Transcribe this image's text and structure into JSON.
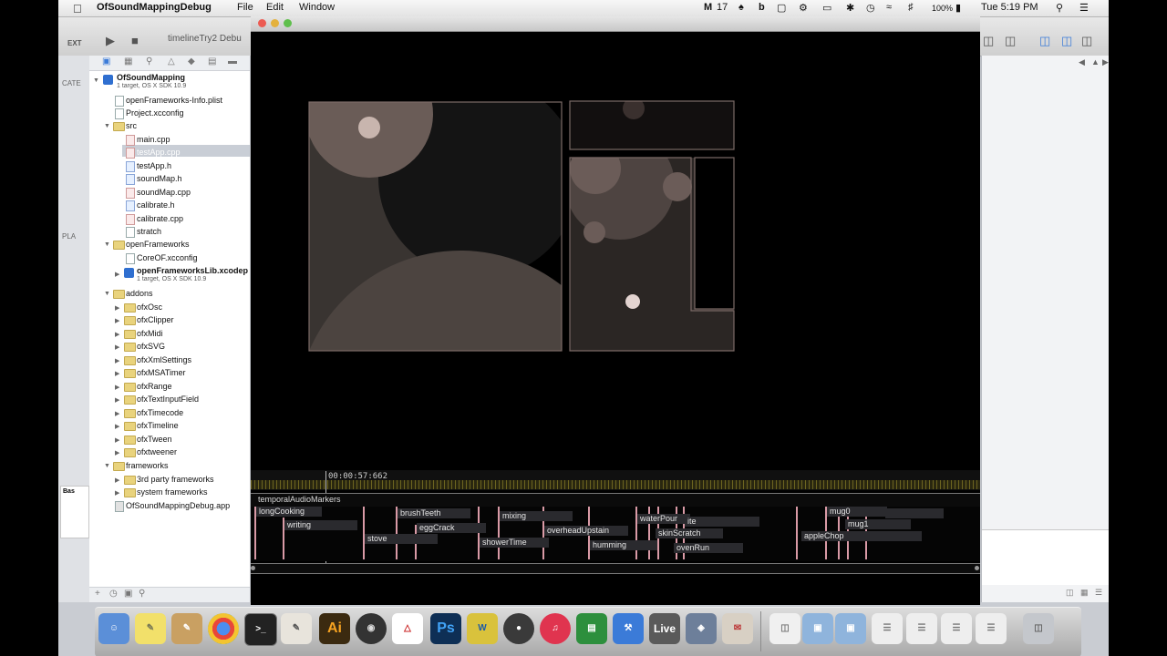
{
  "menubar": {
    "app_name": "OfSoundMappingDebug",
    "menus": [
      "File",
      "Edit",
      "Window"
    ],
    "status": {
      "gmail_count": "17",
      "battery": "100%",
      "clock": "Tue 5:19 PM"
    }
  },
  "xcode": {
    "scheme_label": "timelineTry2 Debu",
    "left_strip_labels": [
      "EXT",
      "CATE",
      "PLA",
      "Bas"
    ],
    "navigator": {
      "project": {
        "name": "OfSoundMapping",
        "subtitle": "1 target, OS X SDK 10.9"
      },
      "rows": [
        {
          "label": "openFrameworks-Info.plist"
        },
        {
          "label": "Project.xcconfig"
        },
        {
          "label": "src"
        },
        {
          "label": "main.cpp"
        },
        {
          "label": "testApp.cpp"
        },
        {
          "label": "testApp.h"
        },
        {
          "label": "soundMap.h"
        },
        {
          "label": "soundMap.cpp"
        },
        {
          "label": "calibrate.h"
        },
        {
          "label": "calibrate.cpp"
        },
        {
          "label": "stratch"
        },
        {
          "label": "openFrameworks"
        },
        {
          "label": "CoreOF.xcconfig"
        },
        {
          "label": "openFrameworksLib.xcodep"
        },
        {
          "label": "1 target, OS X SDK 10.9"
        },
        {
          "label": "addons"
        },
        {
          "label": "ofxOsc"
        },
        {
          "label": "ofxClipper"
        },
        {
          "label": "ofxMidi"
        },
        {
          "label": "ofxSVG"
        },
        {
          "label": "ofxXmlSettings"
        },
        {
          "label": "ofxMSATimer"
        },
        {
          "label": "ofxRange"
        },
        {
          "label": "ofxTextInputField"
        },
        {
          "label": "ofxTimecode"
        },
        {
          "label": "ofxTimeline"
        },
        {
          "label": "ofxTween"
        },
        {
          "label": "ofxtweener"
        },
        {
          "label": "frameworks"
        },
        {
          "label": "3rd party frameworks"
        },
        {
          "label": "system frameworks"
        },
        {
          "label": "OfSoundMappingDebug.app"
        }
      ]
    }
  },
  "timeline": {
    "timecode": "00:00:57:662",
    "track_name": "temporalAudioMarkers",
    "labels": [
      "longCooking",
      "writing",
      "stove",
      "brushTeeth",
      "eggCrack",
      "mixing",
      "showerTime",
      "overheadUpstain",
      "humming",
      "waterPour",
      "ite",
      "skinScratch",
      "ovenRun",
      "mug0",
      "mug1",
      "appleChop"
    ]
  },
  "dock": {
    "apps": [
      "Finder",
      "Stickies",
      "Preview",
      "Chrome",
      "Terminal",
      "TextEdit",
      "Illustrator",
      "Final Cut",
      "Acrobat",
      "Photoshop",
      "Web",
      "GitHub",
      "iTunes",
      "Numbers",
      "Xcode",
      "Live",
      "MAMP",
      "Mail",
      "Trash"
    ]
  },
  "colors": {
    "marker": "#d99aa6",
    "ruler": "#6c6420"
  }
}
